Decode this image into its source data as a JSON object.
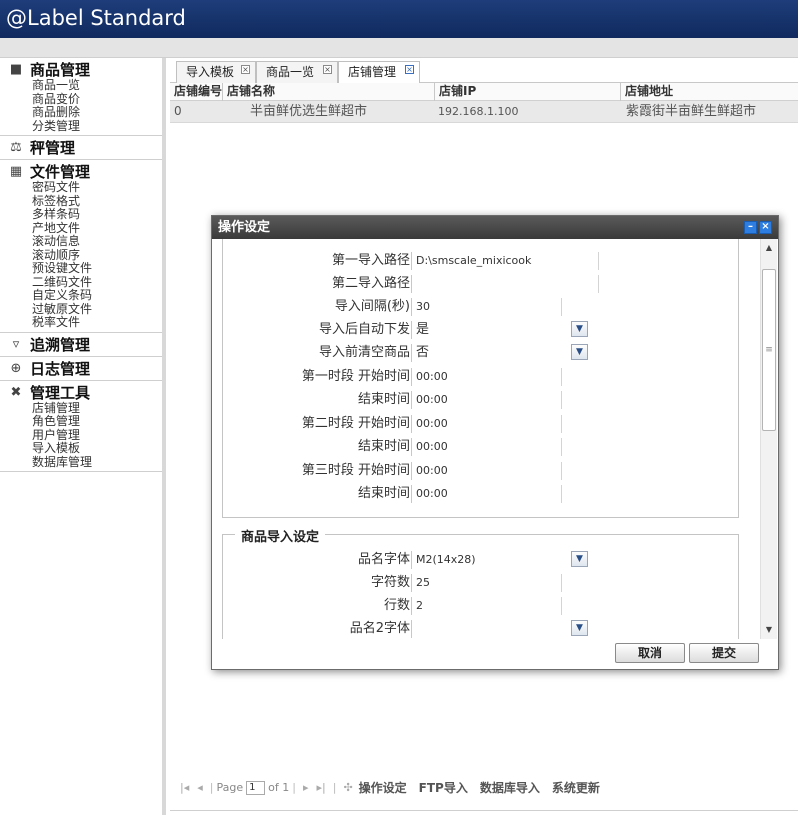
{
  "app": {
    "title": "@Label Standard"
  },
  "sidebar": {
    "groups": [
      {
        "title": "商品管理",
        "icon": "folder-icon",
        "items": [
          "商品一览",
          "商品变价",
          "商品删除",
          "分类管理"
        ]
      },
      {
        "title": "秤管理",
        "icon": "scale-icon",
        "items": []
      },
      {
        "title": "文件管理",
        "icon": "file-manager-icon",
        "items": [
          "密码文件",
          "标签格式",
          "多样条码",
          "产地文件",
          "滚动信息",
          "滚动顺序",
          "预设键文件",
          "二维码文件",
          "自定义条码",
          "过敏原文件",
          "税率文件"
        ]
      },
      {
        "title": "追溯管理",
        "icon": "trace-icon",
        "items": []
      },
      {
        "title": "日志管理",
        "icon": "log-icon",
        "items": []
      },
      {
        "title": "管理工具",
        "icon": "tools-icon",
        "items": [
          "店铺管理",
          "角色管理",
          "用户管理",
          "导入模板",
          "数据库管理"
        ]
      }
    ]
  },
  "tabs": [
    {
      "label": "导入模板"
    },
    {
      "label": "商品一览"
    },
    {
      "label": "店铺管理"
    }
  ],
  "grid": {
    "columns": [
      "店铺编号",
      "店铺名称",
      "店铺IP",
      "店铺地址"
    ],
    "rows": [
      [
        "0",
        "半亩鲜优选生鲜超市",
        "192.168.1.100",
        "紫霞街半亩鲜生鲜超市"
      ]
    ]
  },
  "pager": {
    "page_label": "Page",
    "page_value": "1",
    "of_label": "of 1",
    "actions": [
      "操作设定",
      "FTP导入",
      "数据库导入",
      "系统更新"
    ]
  },
  "dialog": {
    "title": "操作设定",
    "section1": {
      "fields": [
        {
          "label": "第一导入路径",
          "value": "D:\\smscale_mixicook"
        },
        {
          "label": "第二导入路径",
          "value": ""
        },
        {
          "label": "导入间隔(秒)",
          "value": "30"
        },
        {
          "label": "导入后自动下发",
          "value": "是",
          "dropdown": true
        },
        {
          "label": "导入前清空商品",
          "value": "否",
          "dropdown": true
        },
        {
          "label": "第一时段 开始时间",
          "value": "00:00"
        },
        {
          "label": "结束时间",
          "value": "00:00"
        },
        {
          "label": "第二时段 开始时间",
          "value": "00:00"
        },
        {
          "label": "结束时间",
          "value": "00:00"
        },
        {
          "label": "第三时段 开始时间",
          "value": "00:00"
        },
        {
          "label": "结束时间",
          "value": "00:00"
        }
      ]
    },
    "section2": {
      "legend": "商品导入设定",
      "fields": [
        {
          "label": "品名字体",
          "value": "M2(14x28)",
          "dropdown": true
        },
        {
          "label": "字符数",
          "value": "25"
        },
        {
          "label": "行数",
          "value": "2"
        },
        {
          "label": "品名2字体",
          "value": "",
          "dropdown": true
        }
      ]
    },
    "buttons": {
      "cancel": "取消",
      "submit": "提交"
    }
  }
}
